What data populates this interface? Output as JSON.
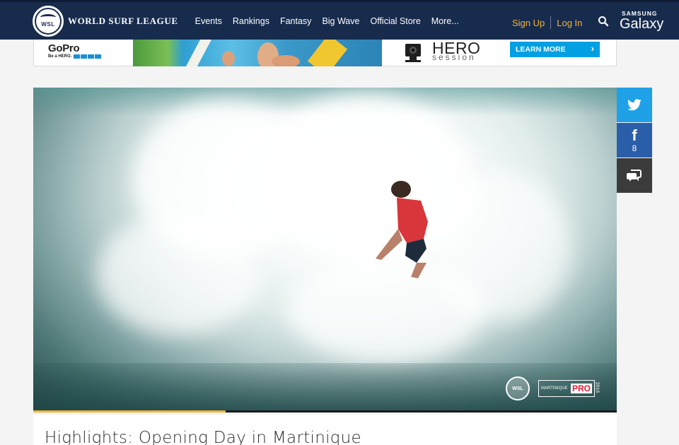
{
  "header": {
    "brand": "WORLD SURF LEAGUE",
    "logo_text": "WSL",
    "nav": [
      "Events",
      "Rankings",
      "Fantasy",
      "Big Wave",
      "Official Store",
      "More..."
    ],
    "sign_up": "Sign Up",
    "log_in": "Log In",
    "search_icon": "search-icon",
    "sponsor_top": "SAMSUNG",
    "sponsor_bottom": "Galaxy",
    "colors": {
      "background": "#172b4d",
      "accent": "#f5b335"
    }
  },
  "ad": {
    "brand": "GoPro",
    "tagline": "Be a HERO.",
    "product_line1": "HERO",
    "product_line2": "session",
    "cta": "LEARN MORE"
  },
  "video": {
    "watermark": "WSL",
    "event_name": "MARTINIQUE",
    "event_suffix": "PRO",
    "event_year": "2016",
    "progress": 0.33
  },
  "social": {
    "twitter_icon": "twitter-icon",
    "facebook_icon": "facebook-icon",
    "facebook_count": "8",
    "comments_icon": "comments-icon",
    "colors": {
      "twitter": "#1ea1e6",
      "facebook": "#2b5ea8",
      "comments": "#3b3b3b"
    }
  },
  "article": {
    "title": "Highlights: Opening Day in Martinique"
  }
}
